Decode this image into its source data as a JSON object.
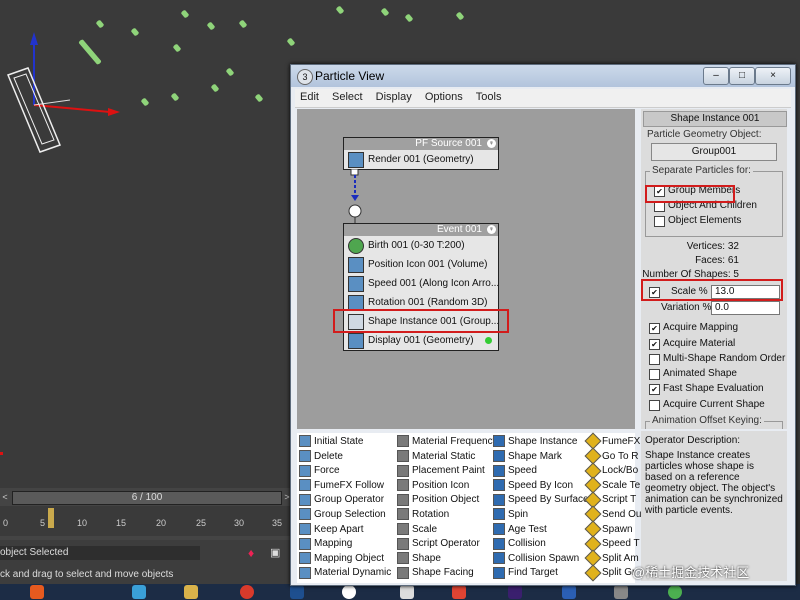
{
  "window": {
    "title": "Particle View",
    "min": "–",
    "max": "□",
    "close": "×"
  },
  "menu": [
    "Edit",
    "Select",
    "Display",
    "Options",
    "Tools"
  ],
  "timeline": {
    "frame": "6 / 100",
    "prev": "<",
    "next": ">",
    "ticks": [
      "0",
      "5",
      "10",
      "15",
      "20",
      "25",
      "30",
      "35"
    ]
  },
  "status": {
    "selection": "object Selected",
    "hint": "ck and drag to select and move objects"
  },
  "source_node": {
    "header": "PF Source 001",
    "ops": [
      "Render 001 (Geometry)"
    ]
  },
  "event_node": {
    "header": "Event 001",
    "ops": [
      "Birth 001 (0-30 T:200)",
      "Position Icon 001 (Volume)",
      "Speed 001 (Along Icon Arro...",
      "Rotation 001 (Random 3D)",
      "Shape Instance 001 (Group...",
      "Display 001 (Geometry)"
    ]
  },
  "panel": {
    "title": "Shape Instance 001",
    "geo_label": "Particle Geometry Object:",
    "geo_button": "Group001",
    "separate_label": "Separate Particles for:",
    "separate": [
      {
        "label": "Group Members",
        "checked": true
      },
      {
        "label": "Object And Children",
        "checked": false
      },
      {
        "label": "Object Elements",
        "checked": false
      }
    ],
    "vertices": "Vertices: 32",
    "faces": "Faces: 61",
    "num_shapes": "Number Of Shapes: 5",
    "scale_label": "Scale %",
    "scale_value": "13.0",
    "variation_label": "Variation %",
    "variation_value": "0.0",
    "options": [
      {
        "label": "Acquire Mapping",
        "checked": true
      },
      {
        "label": "Acquire Material",
        "checked": true
      },
      {
        "label": "Multi-Shape Random Order",
        "checked": false
      },
      {
        "label": "Animated Shape",
        "checked": false
      },
      {
        "label": "Fast Shape Evaluation",
        "checked": true
      },
      {
        "label": "Acquire Current Shape",
        "checked": false
      }
    ],
    "offset_label": "Animation Offset Keying:"
  },
  "depot": [
    [
      "Initial State",
      "Delete",
      "Force",
      "FumeFX Follow",
      "Group Operator",
      "Group Selection",
      "Keep Apart",
      "Mapping",
      "Mapping Object",
      "Material Dynamic"
    ],
    [
      "Material Frequency",
      "Material Static",
      "Placement Paint",
      "Position Icon",
      "Position Object",
      "Rotation",
      "Scale",
      "Script Operator",
      "Shape",
      "Shape Facing"
    ],
    [
      "Shape Instance",
      "Shape Mark",
      "Speed",
      "Speed By Icon",
      "Speed By Surface",
      "Spin",
      "Age Test",
      "Collision",
      "Collision Spawn",
      "Find Target"
    ],
    [
      "FumeFX",
      "Go To R",
      "Lock/Bo",
      "Scale Te",
      "Script T",
      "Send Ou",
      "Spawn",
      "Speed T",
      "Split Am",
      "Split Gr"
    ]
  ],
  "description": {
    "title": "Operator Description:",
    "text": "Shape Instance creates particles whose shape is based on a reference geometry object. The object's animation can be synchronized with particle events."
  },
  "watermark": "@稀土掘金技术社区",
  "colors": {
    "highlight": "#d21c1c",
    "viewport": "#3a3a3a",
    "particle": "#8fd47a"
  }
}
